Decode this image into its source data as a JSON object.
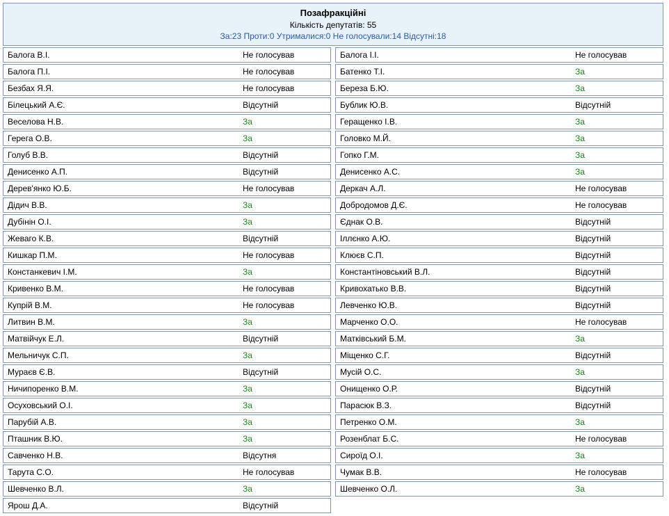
{
  "header": {
    "title": "Позафракційні",
    "count_label": "Кількість депутатів: 55",
    "summary": "За:23 Проти:0 Утрималися:0 Не голосували:14 Відсутні:18"
  },
  "vote_classes": {
    "За": "za",
    "Не голосував": "no",
    "Відсутній": "ab",
    "Відсутня": "ab"
  },
  "left": [
    {
      "name": "Балога В.І.",
      "vote": "Не голосував"
    },
    {
      "name": "Балога П.І.",
      "vote": "Не голосував"
    },
    {
      "name": "Безбах Я.Я.",
      "vote": "Не голосував"
    },
    {
      "name": "Білецький А.Є.",
      "vote": "Відсутній"
    },
    {
      "name": "Веселова Н.В.",
      "vote": "За"
    },
    {
      "name": "Герега О.В.",
      "vote": "За"
    },
    {
      "name": "Голуб В.В.",
      "vote": "Відсутній"
    },
    {
      "name": "Денисенко А.П.",
      "vote": "Відсутній"
    },
    {
      "name": "Дерев'янко Ю.Б.",
      "vote": "Не голосував"
    },
    {
      "name": "Дідич В.В.",
      "vote": "За"
    },
    {
      "name": "Дубінін О.І.",
      "vote": "За"
    },
    {
      "name": "Жеваго К.В.",
      "vote": "Відсутній"
    },
    {
      "name": "Кишкар П.М.",
      "vote": "Не голосував"
    },
    {
      "name": "Констанкевич І.М.",
      "vote": "За"
    },
    {
      "name": "Кривенко В.М.",
      "vote": "Не голосував"
    },
    {
      "name": "Купрій В.М.",
      "vote": "Не голосував"
    },
    {
      "name": "Литвин В.М.",
      "vote": "За"
    },
    {
      "name": "Матвійчук Е.Л.",
      "vote": "Відсутній"
    },
    {
      "name": "Мельничук С.П.",
      "vote": "За"
    },
    {
      "name": "Мураєв Є.В.",
      "vote": "Відсутній"
    },
    {
      "name": "Ничипоренко В.М.",
      "vote": "За"
    },
    {
      "name": "Осуховський О.І.",
      "vote": "За"
    },
    {
      "name": "Парубій А.В.",
      "vote": "За"
    },
    {
      "name": "Пташник В.Ю.",
      "vote": "За"
    },
    {
      "name": "Савченко Н.В.",
      "vote": "Відсутня"
    },
    {
      "name": "Тарута С.О.",
      "vote": "Не голосував"
    },
    {
      "name": "Шевченко В.Л.",
      "vote": "За"
    },
    {
      "name": "Ярош Д.А.",
      "vote": "Відсутній"
    }
  ],
  "right": [
    {
      "name": "Балога І.І.",
      "vote": "Не голосував"
    },
    {
      "name": "Батенко Т.І.",
      "vote": "За"
    },
    {
      "name": "Береза Б.Ю.",
      "vote": "За"
    },
    {
      "name": "Бублик Ю.В.",
      "vote": "Відсутній"
    },
    {
      "name": "Геращенко І.В.",
      "vote": "За"
    },
    {
      "name": "Головко М.Й.",
      "vote": "За"
    },
    {
      "name": "Гопко Г.М.",
      "vote": "За"
    },
    {
      "name": "Денисенко А.С.",
      "vote": "За"
    },
    {
      "name": "Деркач А.Л.",
      "vote": "Не голосував"
    },
    {
      "name": "Добродомов Д.Є.",
      "vote": "Не голосував"
    },
    {
      "name": "Єднак О.В.",
      "vote": "Відсутній"
    },
    {
      "name": "Іллєнко А.Ю.",
      "vote": "Відсутній"
    },
    {
      "name": "Клюєв С.П.",
      "vote": "Відсутній"
    },
    {
      "name": "Константіновський В.Л.",
      "vote": "Відсутній"
    },
    {
      "name": "Кривохатько В.В.",
      "vote": "Відсутній"
    },
    {
      "name": "Левченко Ю.В.",
      "vote": "Відсутній"
    },
    {
      "name": "Марченко О.О.",
      "vote": "Не голосував"
    },
    {
      "name": "Матківський Б.М.",
      "vote": "За"
    },
    {
      "name": "Міщенко С.Г.",
      "vote": "Відсутній"
    },
    {
      "name": "Мусій О.С.",
      "vote": "За"
    },
    {
      "name": "Онищенко О.Р.",
      "vote": "Відсутній"
    },
    {
      "name": "Парасюк В.З.",
      "vote": "Відсутній"
    },
    {
      "name": "Петренко О.М.",
      "vote": "За"
    },
    {
      "name": "Розенблат Б.С.",
      "vote": "Не голосував"
    },
    {
      "name": "Сироїд О.І.",
      "vote": "За"
    },
    {
      "name": "Чумак В.В.",
      "vote": "Не голосував"
    },
    {
      "name": "Шевченко О.Л.",
      "vote": "За"
    }
  ]
}
